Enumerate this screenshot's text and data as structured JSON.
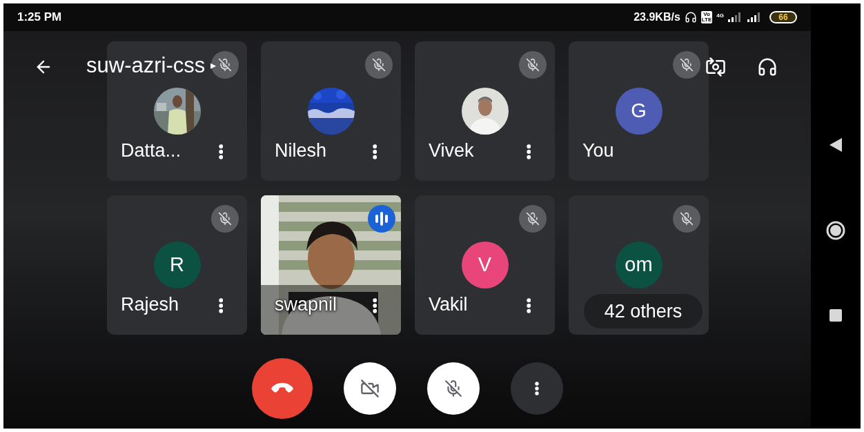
{
  "status_bar": {
    "time": "1:25 PM",
    "speed": "23.9KB/s",
    "volte": [
      "Vo",
      "LTE"
    ],
    "network": "4G",
    "battery": "66"
  },
  "meeting": {
    "title": "suw-azri-css",
    "caret": "▸"
  },
  "tiles": [
    {
      "name": "Datta...",
      "muted": true,
      "menu": true
    },
    {
      "name": "Nilesh",
      "muted": true,
      "menu": true
    },
    {
      "name": "Vivek",
      "muted": true,
      "menu": true
    },
    {
      "kind": "initial",
      "name": "You",
      "initial": "G",
      "color": "#4e5cb3",
      "muted": true,
      "menu": false
    },
    {
      "kind": "initial",
      "name": "Rajesh",
      "initial": "R",
      "color": "#0c5242",
      "muted": true,
      "menu": true
    },
    {
      "kind": "video",
      "name": "swapnil",
      "speaking": true,
      "menu": true
    },
    {
      "kind": "initial",
      "name": "Vakil",
      "initial": "V",
      "color": "#e8457a",
      "muted": true,
      "menu": true
    },
    {
      "kind": "others",
      "initial": "om",
      "color": "#0c5242",
      "muted": true,
      "others": "42 others"
    }
  ]
}
